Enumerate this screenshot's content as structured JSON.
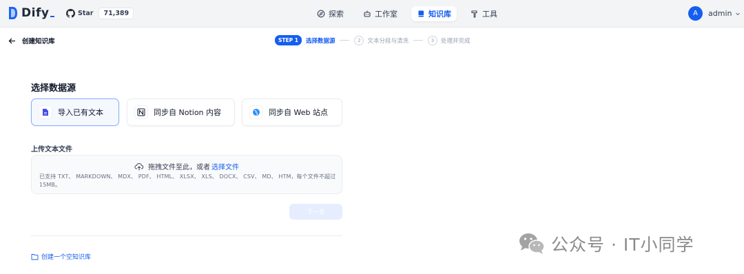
{
  "header": {
    "logo_text": "Dify",
    "github": {
      "label": "Star",
      "count": "71,389"
    },
    "nav": [
      {
        "label": "探索",
        "icon": "compass-icon",
        "active": false
      },
      {
        "label": "工作室",
        "icon": "robot-icon",
        "active": false
      },
      {
        "label": "知识库",
        "icon": "book-icon",
        "active": true
      },
      {
        "label": "工具",
        "icon": "hammer-icon",
        "active": false
      }
    ],
    "user": {
      "initial": "A",
      "name": "admin"
    }
  },
  "subbar": {
    "back_label": "创建知识库",
    "steps": [
      {
        "badge": "STEP 1",
        "label": "选择数据源",
        "active": true
      },
      {
        "badge": "2",
        "label": "文本分段与清洗",
        "active": false
      },
      {
        "badge": "3",
        "label": "处理并完成",
        "active": false
      }
    ]
  },
  "content": {
    "section_title": "选择数据源",
    "sources": [
      {
        "label": "导入已有文本",
        "icon": "document-icon",
        "active": true
      },
      {
        "label": "同步自 Notion 内容",
        "icon": "notion-icon",
        "active": false
      },
      {
        "label": "同步自 Web 站点",
        "icon": "globe-icon",
        "active": false
      }
    ],
    "upload_title": "上传文本文件",
    "dropzone": {
      "text": "拖拽文件至此，或者",
      "link": "选择文件",
      "support": "已支持 TXT、 MARKDOWN、 MDX、 PDF、 HTML、 XLSX、 XLS、 DOCX、 CSV、 MD、 HTM，每个文件不超过 15MB。"
    },
    "next_button": "下一步",
    "empty_link": "创建一个空知识库"
  },
  "watermark": {
    "text": "公众号 · IT小同学"
  },
  "colors": {
    "accent": "#155eef",
    "topbar": "#f3f4f6",
    "muted": "#98a2b3"
  }
}
